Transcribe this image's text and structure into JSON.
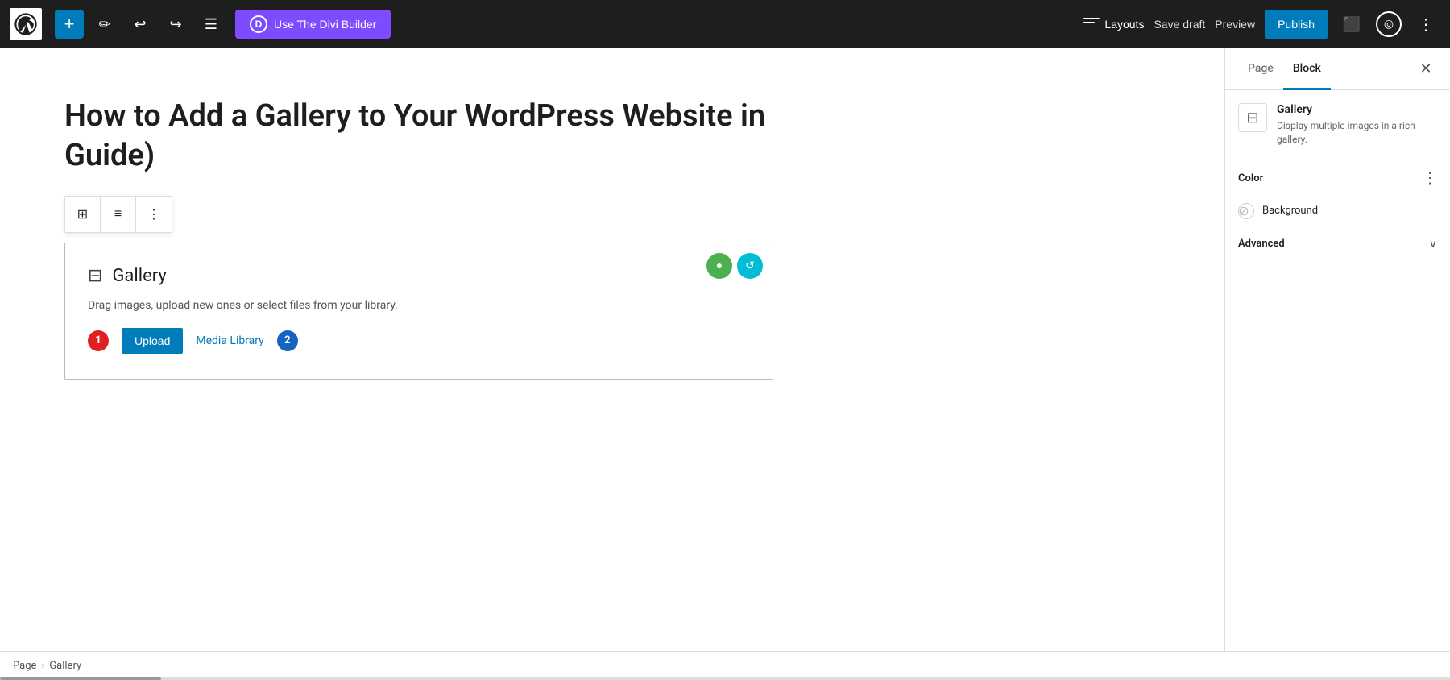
{
  "toolbar": {
    "add_label": "+",
    "divi_builder_label": "Use The Divi Builder",
    "divi_letter": "D",
    "layouts_label": "Layouts",
    "save_draft_label": "Save draft",
    "preview_label": "Preview",
    "publish_label": "Publish",
    "more_label": "⋮"
  },
  "editor": {
    "post_title": "How to Add a Gallery to Your WordPress Website in  Guide)",
    "gallery_block": {
      "title": "Gallery",
      "drag_text": "Drag images, upload new ones or select files from your library.",
      "upload_label": "Upload",
      "media_library_label": "Media Library"
    },
    "annotations": {
      "badge1": "1",
      "badge2": "2"
    }
  },
  "sidebar": {
    "tab_page_label": "Page",
    "tab_block_label": "Block",
    "active_tab": "Block",
    "close_icon": "✕",
    "block_info": {
      "name": "Gallery",
      "description": "Display multiple images in a rich gallery."
    },
    "color_section": {
      "label": "Color",
      "background_label": "Background"
    },
    "advanced_section": {
      "label": "Advanced",
      "collapsed": true,
      "chevron": "∨"
    }
  },
  "breadcrumb": {
    "page_label": "Page",
    "separator": "›",
    "current_label": "Gallery"
  }
}
